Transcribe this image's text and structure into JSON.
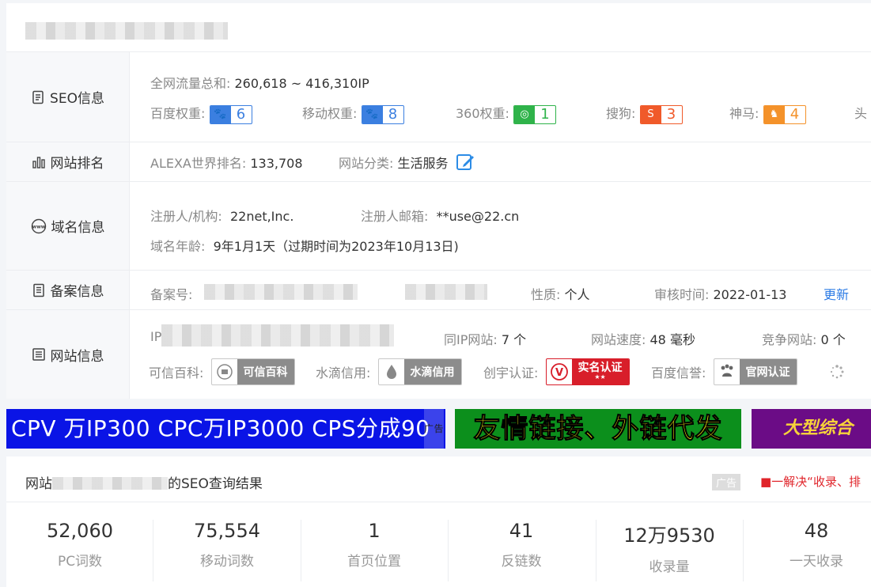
{
  "seo": {
    "label": "SEO信息",
    "traffic_key": "全网流量总和:",
    "traffic_value": "260,618 ~ 416,310IP",
    "weights": [
      {
        "key": "百度权重:",
        "value": "6",
        "color": "#3b7fe0",
        "icon": "baidu-paw-icon"
      },
      {
        "key": "移动权重:",
        "value": "8",
        "color": "#3b7fe0",
        "icon": "baidu-mobile-paw-icon"
      },
      {
        "key": "360权重:",
        "value": "1",
        "color": "#2fb34a",
        "icon": "360-icon"
      },
      {
        "key": "搜狗:",
        "value": "3",
        "color": "#f05a2a",
        "icon": "sogou-icon"
      },
      {
        "key": "神马:",
        "value": "4",
        "color": "#f4922a",
        "icon": "shenma-icon"
      }
    ],
    "truncated_key": "头"
  },
  "rank": {
    "label": "网站排名",
    "alexa_key": "ALEXA世界排名:",
    "alexa_value": "133,708",
    "category_key": "网站分类:",
    "category_value": "生活服务"
  },
  "domain": {
    "label": "域名信息",
    "registrant_key": "注册人/机构:",
    "registrant_value": "22net,Inc.",
    "email_key": "注册人邮箱:",
    "email_value": "**use@22.cn",
    "age_key": "域名年龄:",
    "age_value": "9年1月1天（过期时间为2023年10月13日)"
  },
  "icp": {
    "label": "备案信息",
    "number_key": "备案号:",
    "nature_key": "性质:",
    "nature_value": "个人",
    "audit_key": "审核时间:",
    "audit_value": "2022-01-13",
    "update_link": "更新"
  },
  "site": {
    "label": "网站信息",
    "ip_key": "IP",
    "same_ip_key": "同IP网站:",
    "same_ip_value": "7 个",
    "speed_key": "网站速度:",
    "speed_value": "48 毫秒",
    "compete_key": "竞争网站:",
    "compete_value": "0 个",
    "trust_key": "可信百科:",
    "trust_badge": "可信百科",
    "shuidi_key": "水滴信用:",
    "shuidi_badge": "水滴信用",
    "chuangyu_key": "创宇认证:",
    "chuangyu_badge": "实名认证",
    "chuangyu_sub": "★★",
    "baidu_key": "百度信誉:",
    "baidu_badge": "官网认证"
  },
  "banners": {
    "b1_text": "CPV 万IP300 CPC万IP3000 CPS分成90",
    "b1_ad": "广告",
    "b2_text": "友情链接、外链代发",
    "b3_text": "大型综合"
  },
  "results": {
    "title_prefix": "网站",
    "title_suffix": "的SEO查询结果",
    "ad_tag": "广告",
    "promo": "■一解决“收录、排",
    "stats": [
      {
        "value": "52,060",
        "label": "PC词数"
      },
      {
        "value": "75,554",
        "label": "移动词数"
      },
      {
        "value": "1",
        "label": "首页位置"
      },
      {
        "value": "41",
        "label": "反链数"
      },
      {
        "value": "12万9530",
        "label": "收录量"
      },
      {
        "value": "48",
        "label": "一天收录"
      }
    ]
  }
}
